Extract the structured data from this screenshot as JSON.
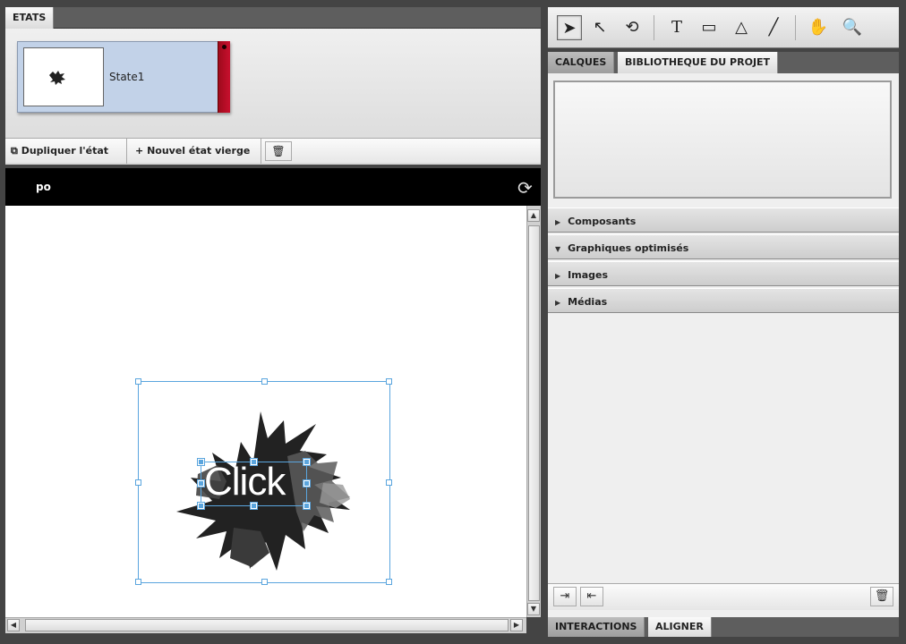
{
  "states_panel": {
    "tab_label": "ETATS",
    "state_name": "State1",
    "duplicate_label": "Dupliquer l'état",
    "new_state_label": "Nouvel état vierge"
  },
  "canvas": {
    "page_title": "po",
    "button_text": "Click"
  },
  "tools": [
    "select",
    "direct-select",
    "transform",
    "text",
    "rectangle",
    "shape",
    "line",
    "hand",
    "zoom"
  ],
  "library": {
    "tabs": [
      "CALQUES",
      "BIBLIOTHEQUE DU PROJET"
    ],
    "sections": [
      {
        "label": "Composants",
        "expanded": false
      },
      {
        "label": "Graphiques optimisés",
        "expanded": true
      },
      {
        "label": "Images",
        "expanded": false
      },
      {
        "label": "Médias",
        "expanded": false
      }
    ]
  },
  "bottom_tabs": [
    "INTERACTIONS",
    "ALIGNER"
  ],
  "colors": {
    "state_card": "#c2d2e8",
    "state_strip": "#c8102e",
    "selection": "#5aa5de"
  }
}
